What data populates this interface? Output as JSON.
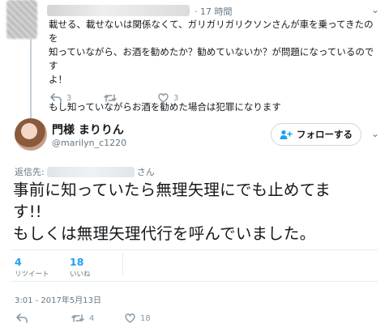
{
  "reply": {
    "time": "· 17 時間",
    "text_lines": [
      "載せる、載せないは関係なくて、ガリガリガリクソンさんが車を乗ってきたのを",
      "知っていながら、お酒を勧めたか？勧めていないか？が問題になっているのです",
      "よ！"
    ],
    "text_line2": "もし知っていながらお酒を勧めた場合は犯罪になります",
    "actions": {
      "reply_count": "3",
      "retweet_count": "",
      "like_count": "3"
    }
  },
  "tweet": {
    "display_name": "門様 まりりん",
    "handle": "@marilyn_c1220",
    "follow_label": "フォローする",
    "reply_to_prefix": "返信先:",
    "reply_to_suffix": "さん",
    "text_lines": [
      "事前に知っていたら無理矢理にでも止めてま",
      "す!!",
      "もしくは無理矢理代行を呼んでいました。"
    ],
    "stats": {
      "retweets_num": "4",
      "retweets_label": "リツイート",
      "likes_num": "18",
      "likes_label": "いいね"
    },
    "timestamp": "3:01 - 2017年5月13日",
    "actions": {
      "reply_count": "",
      "retweet_count": "4",
      "like_count": "18"
    }
  },
  "colors": {
    "accent": "#1da1f2",
    "muted": "#657786",
    "icon": "#8899a6",
    "text": "#14171a"
  }
}
